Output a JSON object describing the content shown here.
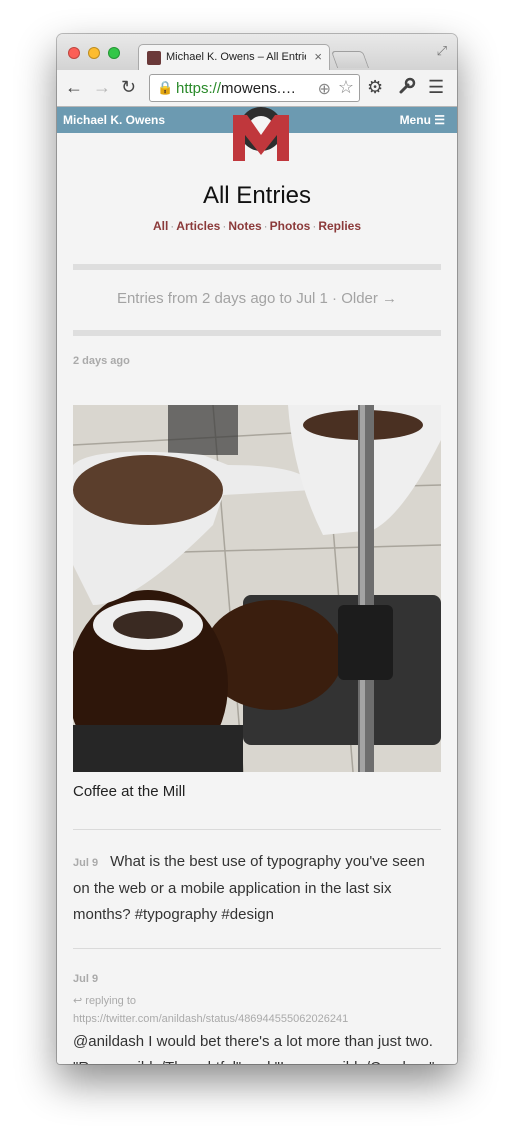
{
  "browser": {
    "tab_title": "Michael K. Owens – All Entries",
    "tab_close": "×",
    "url_scheme": "https://",
    "url_rest": "mowens.…",
    "icons": [
      "back-icon",
      "forward-icon",
      "reload-icon",
      "lock-icon",
      "location-target-icon",
      "bookmark-star-icon",
      "gear-icon",
      "wrench-icon",
      "hamburger-menu-icon",
      "fullscreen-icon"
    ]
  },
  "site": {
    "name": "Michael K. Owens",
    "menu_label": "Menu",
    "bar_color": "#6c9ab1",
    "accent_color": "#8b3a3a"
  },
  "page": {
    "title": "All Entries",
    "filters": [
      "All",
      "Articles",
      "Notes",
      "Photos",
      "Replies"
    ],
    "filter_separator": "·",
    "pager": "Entries from 2 days ago to Jul 1 · Older →"
  },
  "entries": {
    "photo": {
      "date": "2 days ago",
      "caption": "Coffee at the Mill"
    },
    "note": {
      "date": "Jul 9",
      "text": "What is the best use of typography you've seen on the web or a mobile application in the last six months? #typography #design"
    },
    "reply": {
      "date": "Jul 9",
      "replying_label": "replying to",
      "replying_url": "https://twitter.com/anildash/status/486944555062026241",
      "text": "@anildash I would bet there's a lot more than just two. \"Responsible/Thoughtful\" and \"Irresponsible/Careless\" are too limited in scope."
    }
  }
}
